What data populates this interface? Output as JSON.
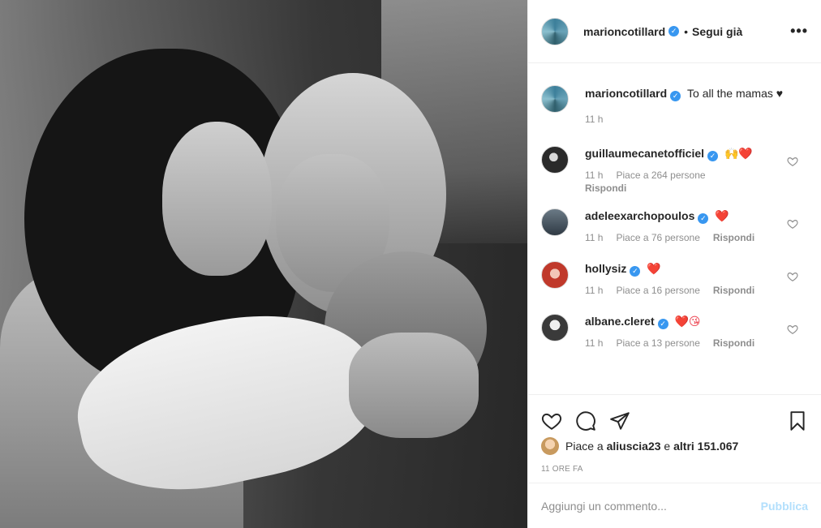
{
  "post": {
    "author": "marioncotillard",
    "follow_dot": "•",
    "follow_status": "Segui già",
    "more_icon": "more-horizontal-icon",
    "caption_text": "To all the mamas ♥",
    "caption_time": "11 h"
  },
  "comments": [
    {
      "user": "guillaumecanetofficiel",
      "text": "🙌❤️",
      "time": "11 h",
      "likes": "Piace a 264 persone",
      "reply": "Rispondi"
    },
    {
      "user": "adeleexarchopoulos",
      "text": "❤️",
      "time": "11 h",
      "likes": "Piace a 76 persone",
      "reply": "Rispondi"
    },
    {
      "user": "hollysiz",
      "text": "❤️",
      "time": "11 h",
      "likes": "Piace a 16 persone",
      "reply": "Rispondi"
    },
    {
      "user": "albane.cleret",
      "text": "❤️😘",
      "time": "11 h",
      "likes": "Piace a 13 persone",
      "reply": "Rispondi"
    }
  ],
  "likes": {
    "prefix": "Piace a",
    "user": "aliuscia23",
    "mid": "e",
    "others": "altri 151.067"
  },
  "time_ago": "11 ORE FA",
  "composer": {
    "placeholder": "Aggiungi un commento...",
    "publish_label": "Pubblica"
  },
  "colors": {
    "verified": "#3897f0",
    "heart": "#ed4956",
    "muted": "#8e8e8e",
    "publish": "#b2dffc"
  }
}
